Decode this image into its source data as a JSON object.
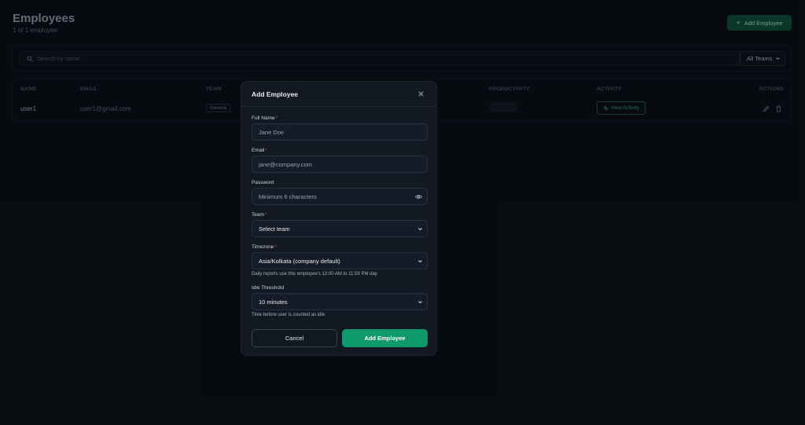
{
  "header": {
    "title": "Employees",
    "subtitle": "1 of 1 employee",
    "add_button_label": "Add Employee"
  },
  "filters": {
    "search_placeholder": "Search by name...",
    "team_filter_value": "All Teams"
  },
  "table": {
    "columns": [
      "NAME",
      "EMAIL",
      "TEAM",
      "PRODUCTIVITY",
      "ACTIVITY",
      "ACTIONS"
    ],
    "rows": [
      {
        "name": "user1",
        "email": "user1@gmail.com",
        "team": "General",
        "activity_label": "View Activity"
      }
    ]
  },
  "modal": {
    "title": "Add Employee",
    "full_name_label": "Full Name",
    "full_name_placeholder": "Jane Doe",
    "email_label": "Email",
    "email_placeholder": "jane@company.com",
    "password_label": "Password",
    "password_placeholder": "Minimum 6 characters",
    "team_label": "Team",
    "team_value": "Select team",
    "timezone_label": "Timezone",
    "timezone_value": "Asia/Kolkata (company default)",
    "timezone_help": "Daily reports use this employee's 12:00 AM to 11:59 PM day",
    "idle_label": "Idle Threshold",
    "idle_value": "10 minutes",
    "idle_help": "Time before user is counted as idle",
    "required_marker": "*",
    "cancel_label": "Cancel",
    "submit_label": "Add Employee"
  },
  "colors": {
    "background": "#0b0f16",
    "modal_background": "#121923",
    "accent_green": "#0f9a6b",
    "required_red": "#c2474f"
  },
  "icons": [
    "plus-icon",
    "search-icon",
    "chevron-down-icon",
    "activity-icon",
    "edit-icon",
    "trash-icon",
    "close-icon",
    "eye-icon"
  ]
}
